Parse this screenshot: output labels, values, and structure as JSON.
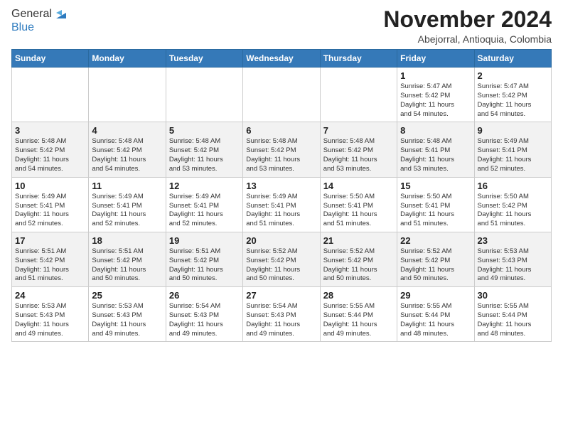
{
  "header": {
    "logo_general": "General",
    "logo_blue": "Blue",
    "month_year": "November 2024",
    "location": "Abejorral, Antioquia, Colombia"
  },
  "days_of_week": [
    "Sunday",
    "Monday",
    "Tuesday",
    "Wednesday",
    "Thursday",
    "Friday",
    "Saturday"
  ],
  "weeks": [
    {
      "days": [
        {
          "num": "",
          "info": ""
        },
        {
          "num": "",
          "info": ""
        },
        {
          "num": "",
          "info": ""
        },
        {
          "num": "",
          "info": ""
        },
        {
          "num": "",
          "info": ""
        },
        {
          "num": "1",
          "info": "Sunrise: 5:47 AM\nSunset: 5:42 PM\nDaylight: 11 hours\nand 54 minutes."
        },
        {
          "num": "2",
          "info": "Sunrise: 5:47 AM\nSunset: 5:42 PM\nDaylight: 11 hours\nand 54 minutes."
        }
      ]
    },
    {
      "days": [
        {
          "num": "3",
          "info": "Sunrise: 5:48 AM\nSunset: 5:42 PM\nDaylight: 11 hours\nand 54 minutes."
        },
        {
          "num": "4",
          "info": "Sunrise: 5:48 AM\nSunset: 5:42 PM\nDaylight: 11 hours\nand 54 minutes."
        },
        {
          "num": "5",
          "info": "Sunrise: 5:48 AM\nSunset: 5:42 PM\nDaylight: 11 hours\nand 53 minutes."
        },
        {
          "num": "6",
          "info": "Sunrise: 5:48 AM\nSunset: 5:42 PM\nDaylight: 11 hours\nand 53 minutes."
        },
        {
          "num": "7",
          "info": "Sunrise: 5:48 AM\nSunset: 5:42 PM\nDaylight: 11 hours\nand 53 minutes."
        },
        {
          "num": "8",
          "info": "Sunrise: 5:48 AM\nSunset: 5:41 PM\nDaylight: 11 hours\nand 53 minutes."
        },
        {
          "num": "9",
          "info": "Sunrise: 5:49 AM\nSunset: 5:41 PM\nDaylight: 11 hours\nand 52 minutes."
        }
      ]
    },
    {
      "days": [
        {
          "num": "10",
          "info": "Sunrise: 5:49 AM\nSunset: 5:41 PM\nDaylight: 11 hours\nand 52 minutes."
        },
        {
          "num": "11",
          "info": "Sunrise: 5:49 AM\nSunset: 5:41 PM\nDaylight: 11 hours\nand 52 minutes."
        },
        {
          "num": "12",
          "info": "Sunrise: 5:49 AM\nSunset: 5:41 PM\nDaylight: 11 hours\nand 52 minutes."
        },
        {
          "num": "13",
          "info": "Sunrise: 5:49 AM\nSunset: 5:41 PM\nDaylight: 11 hours\nand 51 minutes."
        },
        {
          "num": "14",
          "info": "Sunrise: 5:50 AM\nSunset: 5:41 PM\nDaylight: 11 hours\nand 51 minutes."
        },
        {
          "num": "15",
          "info": "Sunrise: 5:50 AM\nSunset: 5:41 PM\nDaylight: 11 hours\nand 51 minutes."
        },
        {
          "num": "16",
          "info": "Sunrise: 5:50 AM\nSunset: 5:42 PM\nDaylight: 11 hours\nand 51 minutes."
        }
      ]
    },
    {
      "days": [
        {
          "num": "17",
          "info": "Sunrise: 5:51 AM\nSunset: 5:42 PM\nDaylight: 11 hours\nand 51 minutes."
        },
        {
          "num": "18",
          "info": "Sunrise: 5:51 AM\nSunset: 5:42 PM\nDaylight: 11 hours\nand 50 minutes."
        },
        {
          "num": "19",
          "info": "Sunrise: 5:51 AM\nSunset: 5:42 PM\nDaylight: 11 hours\nand 50 minutes."
        },
        {
          "num": "20",
          "info": "Sunrise: 5:52 AM\nSunset: 5:42 PM\nDaylight: 11 hours\nand 50 minutes."
        },
        {
          "num": "21",
          "info": "Sunrise: 5:52 AM\nSunset: 5:42 PM\nDaylight: 11 hours\nand 50 minutes."
        },
        {
          "num": "22",
          "info": "Sunrise: 5:52 AM\nSunset: 5:42 PM\nDaylight: 11 hours\nand 50 minutes."
        },
        {
          "num": "23",
          "info": "Sunrise: 5:53 AM\nSunset: 5:43 PM\nDaylight: 11 hours\nand 49 minutes."
        }
      ]
    },
    {
      "days": [
        {
          "num": "24",
          "info": "Sunrise: 5:53 AM\nSunset: 5:43 PM\nDaylight: 11 hours\nand 49 minutes."
        },
        {
          "num": "25",
          "info": "Sunrise: 5:53 AM\nSunset: 5:43 PM\nDaylight: 11 hours\nand 49 minutes."
        },
        {
          "num": "26",
          "info": "Sunrise: 5:54 AM\nSunset: 5:43 PM\nDaylight: 11 hours\nand 49 minutes."
        },
        {
          "num": "27",
          "info": "Sunrise: 5:54 AM\nSunset: 5:43 PM\nDaylight: 11 hours\nand 49 minutes."
        },
        {
          "num": "28",
          "info": "Sunrise: 5:55 AM\nSunset: 5:44 PM\nDaylight: 11 hours\nand 49 minutes."
        },
        {
          "num": "29",
          "info": "Sunrise: 5:55 AM\nSunset: 5:44 PM\nDaylight: 11 hours\nand 48 minutes."
        },
        {
          "num": "30",
          "info": "Sunrise: 5:55 AM\nSunset: 5:44 PM\nDaylight: 11 hours\nand 48 minutes."
        }
      ]
    }
  ]
}
